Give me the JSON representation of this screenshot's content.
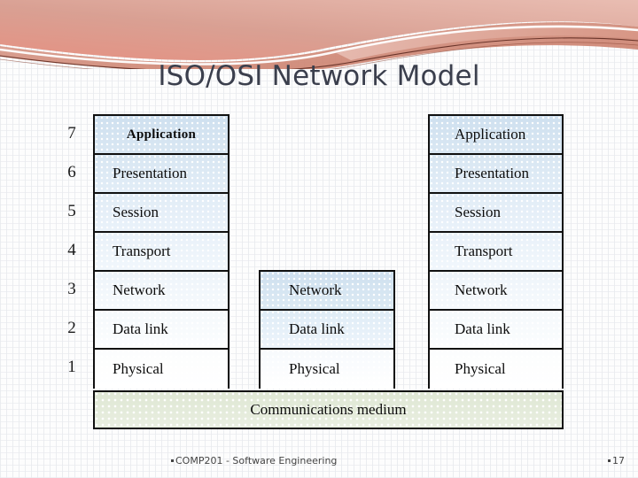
{
  "slide": {
    "title": "ISO/OSI Network Model",
    "title_color": "#3b3f4d",
    "background_color": "#fdfdfd"
  },
  "decor": {
    "swoosh_name": "header-swoosh-graphic",
    "colors": {
      "salmon_dark": "#cb7a6a",
      "salmon_mid": "#d79281",
      "salmon_light": "#e6b0a2",
      "maroon_line": "#5e2a20",
      "white": "#ffffff"
    }
  },
  "diagram": {
    "layer_numbers": [
      "7",
      "6",
      "5",
      "4",
      "3",
      "2",
      "1"
    ],
    "left_stack": {
      "name": "end-system-left",
      "layers": [
        {
          "number": "7",
          "label": "Application",
          "fill": "fill-7",
          "emphasis": true
        },
        {
          "number": "6",
          "label": "Presentation",
          "fill": "fill-6",
          "emphasis": false
        },
        {
          "number": "5",
          "label": "Session",
          "fill": "fill-5",
          "emphasis": false
        },
        {
          "number": "4",
          "label": "Transport",
          "fill": "fill-4",
          "emphasis": false
        },
        {
          "number": "3",
          "label": "Network",
          "fill": "fill-3",
          "emphasis": false
        },
        {
          "number": "2",
          "label": "Data link",
          "fill": "fill-2",
          "emphasis": false
        },
        {
          "number": "1",
          "label": "Physical",
          "fill": "fill-1",
          "emphasis": false
        }
      ]
    },
    "middle_stack": {
      "name": "intermediate-node",
      "layers": [
        {
          "number": "3",
          "label": "Network",
          "fill": "mid-3"
        },
        {
          "number": "2",
          "label": "Data link",
          "fill": "mid-2"
        },
        {
          "number": "1",
          "label": "Physical",
          "fill": "mid-1"
        }
      ]
    },
    "right_stack": {
      "name": "end-system-right",
      "layers": [
        {
          "number": "7",
          "label": "Application",
          "fill": "fill-7"
        },
        {
          "number": "6",
          "label": "Presentation",
          "fill": "fill-6"
        },
        {
          "number": "5",
          "label": "Session",
          "fill": "fill-5"
        },
        {
          "number": "4",
          "label": "Transport",
          "fill": "fill-4"
        },
        {
          "number": "3",
          "label": "Network",
          "fill": "fill-3"
        },
        {
          "number": "2",
          "label": "Data link",
          "fill": "fill-2"
        },
        {
          "number": "1",
          "label": "Physical",
          "fill": "fill-1"
        }
      ]
    },
    "medium": {
      "label": "Communications medium",
      "fill_color": "#e3ead8"
    }
  },
  "footer": {
    "course": "COMP201 - Software Engineering",
    "page_number": "17"
  }
}
